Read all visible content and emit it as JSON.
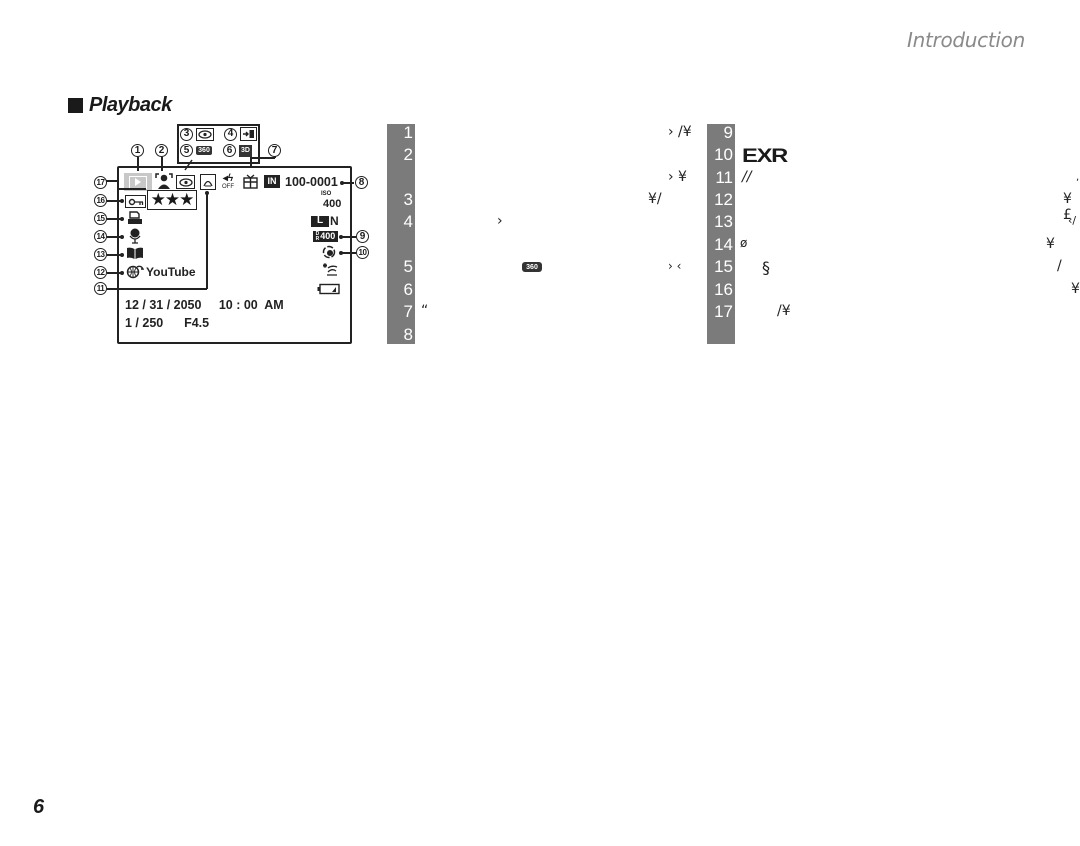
{
  "header": {
    "title": "Introduction"
  },
  "section": {
    "title": "Playback"
  },
  "page": {
    "number": "6"
  },
  "diagram": {
    "callouts": [
      "1",
      "2",
      "3",
      "4",
      "5",
      "6",
      "7",
      "8",
      "9",
      "10",
      "11",
      "12",
      "13",
      "14",
      "15",
      "16",
      "17"
    ],
    "file_number": "100-0001",
    "iso_label": "ISO",
    "iso_value": "400",
    "image_size": "L",
    "image_quality": "N",
    "dr_value": "400",
    "rating_stars": "★★★",
    "youtube": "YouTube",
    "internal_memory": "IN",
    "sound_off": "OFF",
    "date_time": "12 / 31 / 2050     10 : 00  AM",
    "exposure": "1 / 250      F4.5",
    "icons": {
      "playback": "playback-icon",
      "face_detection": "face-detection-icon",
      "red_eye": "red-eye-removal-icon",
      "transfer": "transfer-icon",
      "motion_panorama": "motion-panorama-360-icon",
      "three_d": "3d-icon",
      "gift": "gift-image-icon",
      "internal_memory": "internal-memory-icon",
      "dr": "dynamic-range-icon",
      "film_sim": "film-simulation-icon",
      "scene": "scene-icon",
      "battery": "battery-icon",
      "protect": "protect-key-icon",
      "print": "print-order-icon",
      "voice": "voice-memo-icon",
      "photobook": "photobook-icon",
      "upload": "upload-globe-icon",
      "advanced": "advanced-mode-icon"
    }
  },
  "table_left": {
    "rows": [
      {
        "num": "1",
        "text_right": "› /¥"
      },
      {
        "num": "2",
        "text_right": ""
      },
      {
        "num": "",
        "text_right": "› ¥"
      },
      {
        "num": "3",
        "text_right": "¥/"
      },
      {
        "num": "4",
        "text_mid": "›"
      },
      {
        "num": "",
        "text_right": ""
      },
      {
        "num": "5",
        "text_right": "›  ‹",
        "icon": "360"
      },
      {
        "num": "6",
        "text_left": ""
      },
      {
        "num": "7",
        "text_left": "“"
      },
      {
        "num": "8",
        "text_left": ""
      }
    ]
  },
  "table_right": {
    "rows": [
      {
        "num": "9",
        "text_left": ""
      },
      {
        "num": "10",
        "text_left": "EXR"
      },
      {
        "num": "11",
        "text_left": "//",
        "text_right": ","
      },
      {
        "num": "12",
        "text_right": "¥£"
      },
      {
        "num": "13",
        "text_right": "‹/"
      },
      {
        "num": "14",
        "text_left": "ø",
        "text_right": "¥"
      },
      {
        "num": "15",
        "text_left": "§",
        "text_right": "/"
      },
      {
        "num": "16",
        "text_right": "¥"
      },
      {
        "num": "17",
        "text_left": "/¥"
      }
    ]
  }
}
